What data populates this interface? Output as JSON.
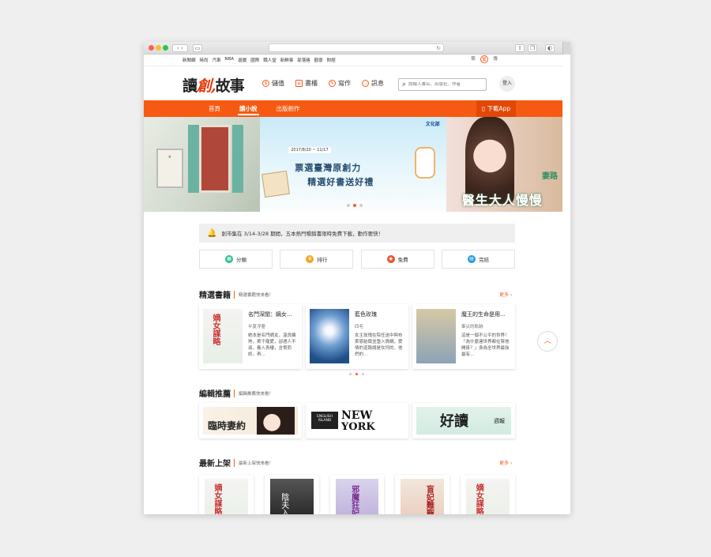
{
  "browser": {
    "url": ""
  },
  "topnav": {
    "links": [
      "新聞網",
      "時尚",
      "汽車",
      "NBA",
      "遊戲",
      "國際",
      "職人堂",
      "新鮮事",
      "部落格",
      "觀景",
      "財經"
    ],
    "langs": [
      "簡",
      "繁",
      "傳"
    ],
    "active_lang": "繁"
  },
  "header": {
    "logo_a": "讀",
    "logo_b": "創,",
    "logo_c": "故事",
    "nav": [
      {
        "icon": "coin-icon",
        "label": "儲值"
      },
      {
        "icon": "bookshelf-icon",
        "label": "書櫃"
      },
      {
        "icon": "pen-icon",
        "label": "寫作"
      },
      {
        "icon": "message-icon",
        "label": "訊息"
      }
    ],
    "search_placeholder": "請輸入書名、出版社、作者",
    "login": "登入"
  },
  "mainnav": {
    "tabs": [
      "首頁",
      "讀小說",
      "出版創作"
    ],
    "active": "讀小說",
    "download": "下載App"
  },
  "banner": {
    "date": "2017/8/20 ~ 11/17",
    "line1": "票選臺灣原創力",
    "line2": "精選好書送好禮",
    "publisher": "文化部",
    "right_title": "醫生大人慢慢",
    "right_sub": "妻路",
    "slides": 3,
    "active_slide": 1
  },
  "notice": {
    "text": "創市集在 3/14-3/28 期間，五本熱門暢銷書限時免費下載，動作要快！"
  },
  "quick": [
    {
      "label": "分類",
      "icon": "grid-icon",
      "color": "#2bbf8a"
    },
    {
      "label": "排行",
      "icon": "trophy-icon",
      "color": "#f5a623"
    },
    {
      "label": "免費",
      "icon": "tag-icon",
      "color": "#f2522a"
    },
    {
      "label": "完結",
      "icon": "book-icon",
      "color": "#1f9bd6"
    }
  ],
  "featured": {
    "title": "精選書籍",
    "subtitle": "精選書籍快來看！",
    "more": "更多",
    "books": [
      {
        "title": "名門深閨：嫡女...",
        "author": "半夏浮塵",
        "desc": "她本是名門嫡女，溫良嫻熟，罵千寵愛，卻遇人不淑，養入青樓，含恨而終。再..."
      },
      {
        "title": "藍色玫瑰",
        "author": "四毛",
        "desc": "女主玫瑰在院任送中與布萊恩結識並墮入情網，愛情的道路總是坎坷的，他們的..."
      },
      {
        "title": "魔王的生命是用...",
        "author": "筆尖的軌跡",
        "desc": "這是一個不公平的世界！「為什麼連世界都在幫他開掛？」身為全世界最強最有..."
      }
    ],
    "pages": 3,
    "active_page": 1
  },
  "editors": {
    "title": "編輯推薦",
    "subtitle": "編輯推薦快來看！",
    "promos": [
      {
        "text": "臨時妻約"
      },
      {
        "text1": "NEW",
        "text2": "YORK",
        "sign": "ENGLISH ISLAND"
      },
      {
        "text": "好讀",
        "tag": "週報"
      }
    ]
  },
  "newest": {
    "title": "最新上架",
    "subtitle": "最新上架快來看！",
    "more": "更多",
    "count": 6
  },
  "scroll_top": "︿"
}
